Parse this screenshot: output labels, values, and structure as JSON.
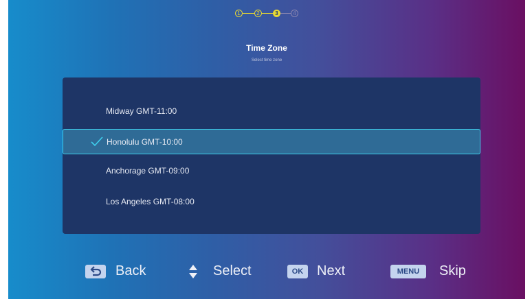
{
  "stepper": {
    "steps": [
      "1",
      "2",
      "3",
      "4"
    ],
    "current": 3
  },
  "header": {
    "title": "Time Zone",
    "subtitle": "Select time zone"
  },
  "list": {
    "items": [
      {
        "label": "Midway GMT-11:00",
        "selected": false
      },
      {
        "label": "Honolulu GMT-10:00",
        "selected": true
      },
      {
        "label": "Anchorage GMT-09:00",
        "selected": false
      },
      {
        "label": "Los Angeles GMT-08:00",
        "selected": false
      }
    ]
  },
  "hints": {
    "back": {
      "icon": "back-arrow-icon",
      "label": "Back"
    },
    "select": {
      "icon": "up-down-arrows-icon",
      "label": "Select"
    },
    "next": {
      "key": "OK",
      "label": "Next"
    },
    "skip": {
      "key": "MENU",
      "label": "Skip"
    }
  },
  "colors": {
    "accent_yellow": "#e8d832",
    "selection_border": "#3fd0ee",
    "panel_bg": "#1e3566"
  }
}
